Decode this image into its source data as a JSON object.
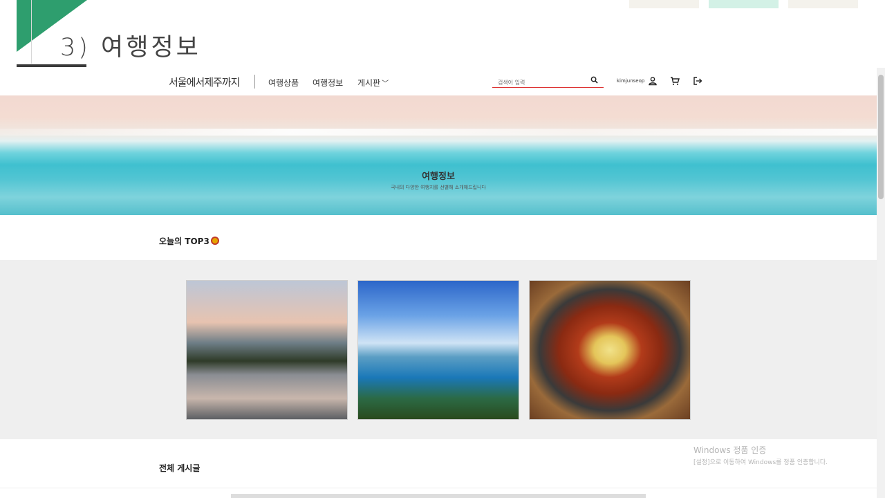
{
  "slide": {
    "title": "3) 여행정보"
  },
  "nav": {
    "logo": "서울에서제주까지",
    "links": [
      "여행상품",
      "여행정보",
      "게시판"
    ],
    "dropdown_chevron": "﹀",
    "search_placeholder": "검색어 입력",
    "username": "kimjunseop"
  },
  "hero": {
    "title": "여행정보",
    "subtitle": "국내의 다양한 여행지를 선별해 소개해드립니다"
  },
  "top3": {
    "title": "오늘의 TOP3",
    "cards": [
      {
        "image": "lake-sunset-photo"
      },
      {
        "image": "sea-islands-photo"
      },
      {
        "image": "dakgalbi-food-photo"
      }
    ]
  },
  "posts": {
    "title": "전체 게시글"
  },
  "watermark": {
    "line1": "Windows 정품 인증",
    "line2": "[설정]으로 이동하여 Windows를 정품 인증합니다."
  },
  "colors": {
    "accent_green": "#2e9e6e",
    "search_underline": "#dd3333"
  }
}
